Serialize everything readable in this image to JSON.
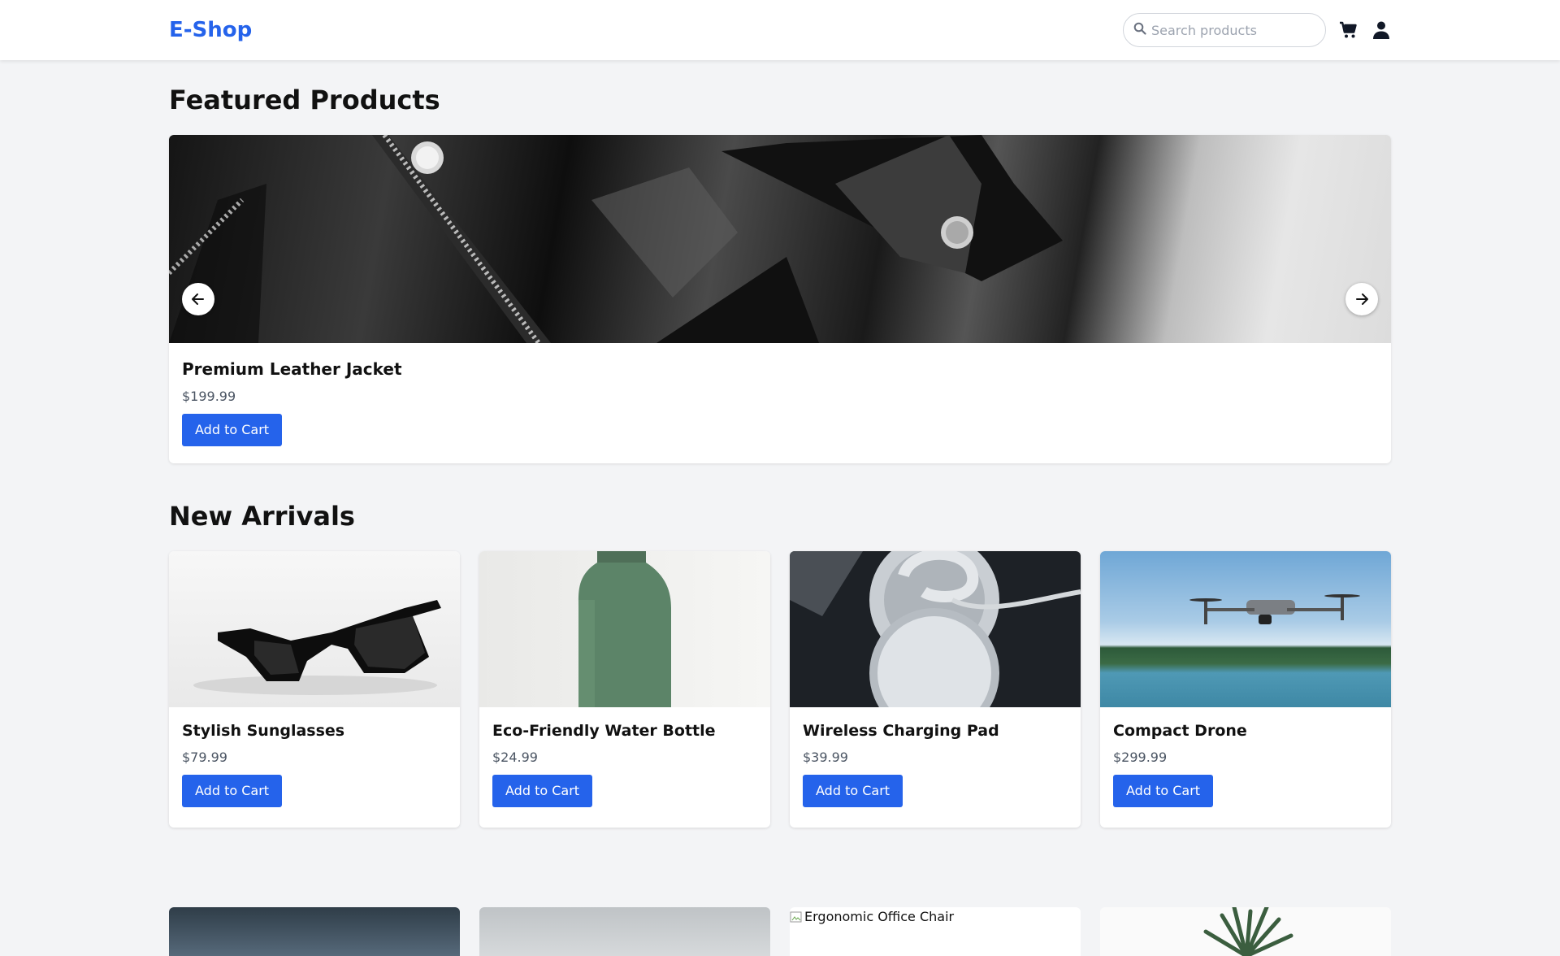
{
  "header": {
    "logo": "E-Shop",
    "search_placeholder": "Search products",
    "icons": [
      "search-icon",
      "cart-icon",
      "user-icon"
    ]
  },
  "featured": {
    "title": "Featured Products",
    "product": {
      "name": "Premium Leather Jacket",
      "price": "$199.99",
      "button": "Add to Cart"
    }
  },
  "arrivals": {
    "title": "New Arrivals",
    "products": [
      {
        "name": "Stylish Sunglasses",
        "price": "$79.99",
        "button": "Add to Cart"
      },
      {
        "name": "Eco-Friendly Water Bottle",
        "price": "$24.99",
        "button": "Add to Cart"
      },
      {
        "name": "Wireless Charging Pad",
        "price": "$39.99",
        "button": "Add to Cart"
      },
      {
        "name": "Compact Drone",
        "price": "$299.99",
        "button": "Add to Cart"
      }
    ],
    "row2": [
      {
        "alt": ""
      },
      {
        "alt": ""
      },
      {
        "alt": "Ergonomic Office Chair"
      },
      {
        "alt": ""
      }
    ]
  },
  "colors": {
    "accent": "#2563eb",
    "background": "#f3f4f6",
    "price": "#4b5563"
  }
}
